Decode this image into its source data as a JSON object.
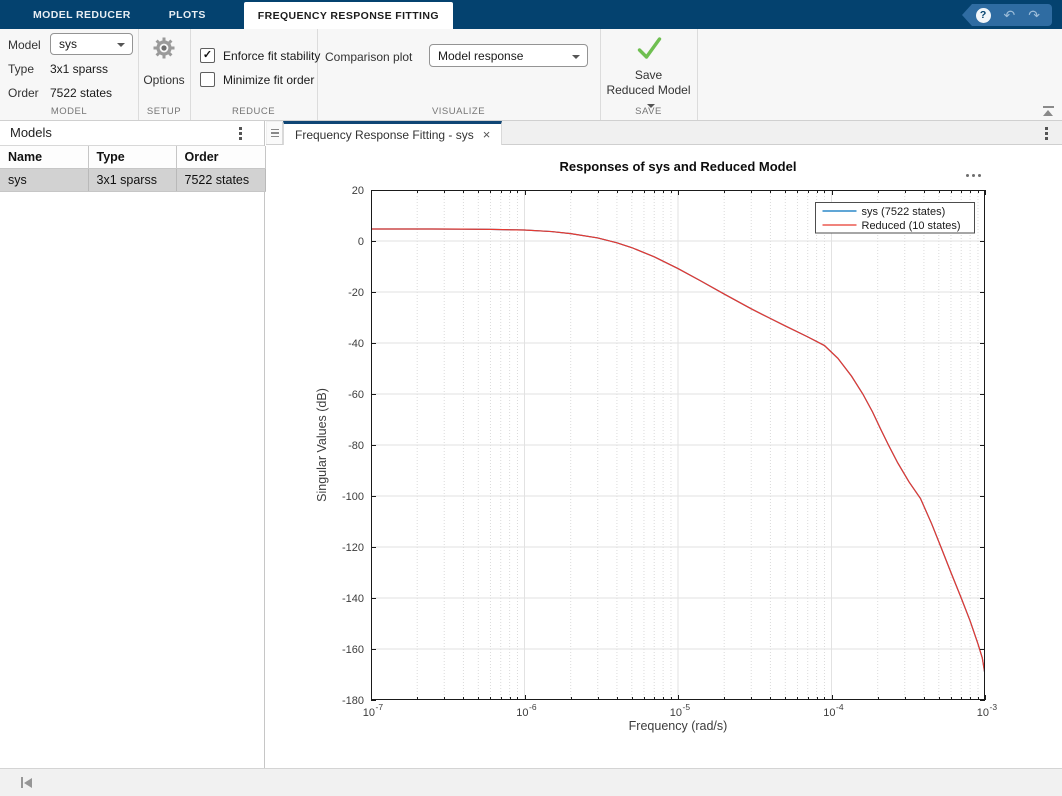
{
  "app": {
    "titlebar_tabs": [
      {
        "label": "MODEL REDUCER"
      },
      {
        "label": "PLOTS"
      },
      {
        "label": "FREQUENCY RESPONSE FITTING"
      }
    ],
    "active_tab": "FREQUENCY RESPONSE FITTING",
    "quick_access": {
      "help_icon": "?",
      "undo_icon": "↶",
      "redo_icon": "↷"
    }
  },
  "ribbon": {
    "sections": {
      "model": "MODEL",
      "setup": "SETUP",
      "reduce": "REDUCE",
      "visualize": "VISUALIZE",
      "save": "SAVE"
    },
    "model": {
      "label": "Model",
      "value": "sys",
      "type_label": "Type",
      "type_value": "3x1 sparss",
      "order_label": "Order",
      "order_value": "7522 states"
    },
    "setup": {
      "options_label": "Options",
      "icon": "gear-icon"
    },
    "reduce": {
      "check_glyph": "✓",
      "checkboxes": [
        {
          "label": "Enforce fit stability",
          "checked": true
        },
        {
          "label": "Minimize fit order",
          "checked": false
        }
      ]
    },
    "visualize": {
      "label": "Comparison plot",
      "dropdown_value": "Model response"
    },
    "save": {
      "line1": "Save",
      "line2": "Reduced Model",
      "icon": "green-check-icon"
    }
  },
  "models_panel": {
    "title": "Models",
    "columns": [
      "Name",
      "Type",
      "Order"
    ],
    "rows": [
      {
        "name": "sys",
        "type": "3x1 sparss",
        "order": "7522 states",
        "selected": true
      }
    ]
  },
  "document": {
    "tab_label": "Frequency Response Fitting - sys",
    "close_icon": "×"
  },
  "chart_data": {
    "type": "line",
    "title": "Responses of sys and Reduced Model",
    "xlabel": "Frequency (rad/s)",
    "ylabel": "Singular Values (dB)",
    "x_scale": "log",
    "xlim": [
      1e-07,
      0.001
    ],
    "xlim_exp": [
      -7,
      -3
    ],
    "xtick_exponents": [
      -7,
      -6,
      -5,
      -4,
      -3
    ],
    "ylim": [
      -180,
      20
    ],
    "yticks": [
      20,
      0,
      -20,
      -40,
      -60,
      -80,
      -100,
      -120,
      -140,
      -160,
      -180
    ],
    "grid": true,
    "minor_grid": true,
    "legend_position": "top-right",
    "note": "both curves overlap almost exactly; red (Reduced) is drawn on top of blue (sys)",
    "x": [
      1e-07,
      1.5e-07,
      2.5e-07,
      4e-07,
      6e-07,
      1e-06,
      1.5e-06,
      2e-06,
      3e-06,
      4e-06,
      5e-06,
      7e-06,
      1e-05,
      1.4e-05,
      2e-05,
      3e-05,
      4e-05,
      5e-05,
      7e-05,
      9e-05,
      0.00011,
      0.000135,
      0.00016,
      0.000185,
      0.00021,
      0.000235,
      0.00027,
      0.00032,
      0.00038,
      0.00045,
      0.00052,
      0.0006,
      0.0007,
      0.0008,
      0.0009,
      0.00096,
      0.001
    ],
    "series": [
      {
        "name": "sys (7522 states)",
        "color": "#0072bd",
        "values_db": [
          4.7,
          4.7,
          4.7,
          4.65,
          4.55,
          4.3,
          3.7,
          2.9,
          1.2,
          -0.7,
          -2.6,
          -6.2,
          -10.8,
          -15.6,
          -20.8,
          -26.6,
          -30.4,
          -33.3,
          -37.6,
          -41,
          -46,
          -53,
          -60,
          -67,
          -74,
          -80,
          -87,
          -94.5,
          -101,
          -111,
          -120.5,
          -130,
          -140,
          -149,
          -158,
          -163.5,
          -170
        ]
      },
      {
        "name": "Reduced (10 states)",
        "color": "#e8392f",
        "values_db": [
          4.7,
          4.7,
          4.7,
          4.65,
          4.55,
          4.3,
          3.7,
          2.9,
          1.2,
          -0.7,
          -2.6,
          -6.2,
          -10.8,
          -15.6,
          -20.8,
          -26.6,
          -30.4,
          -33.3,
          -37.6,
          -41,
          -46,
          -53,
          -60,
          -67,
          -74,
          -80,
          -87,
          -94.5,
          -101,
          -111,
          -120.5,
          -130,
          -140,
          -149,
          -158,
          -163.5,
          -170
        ]
      }
    ]
  }
}
